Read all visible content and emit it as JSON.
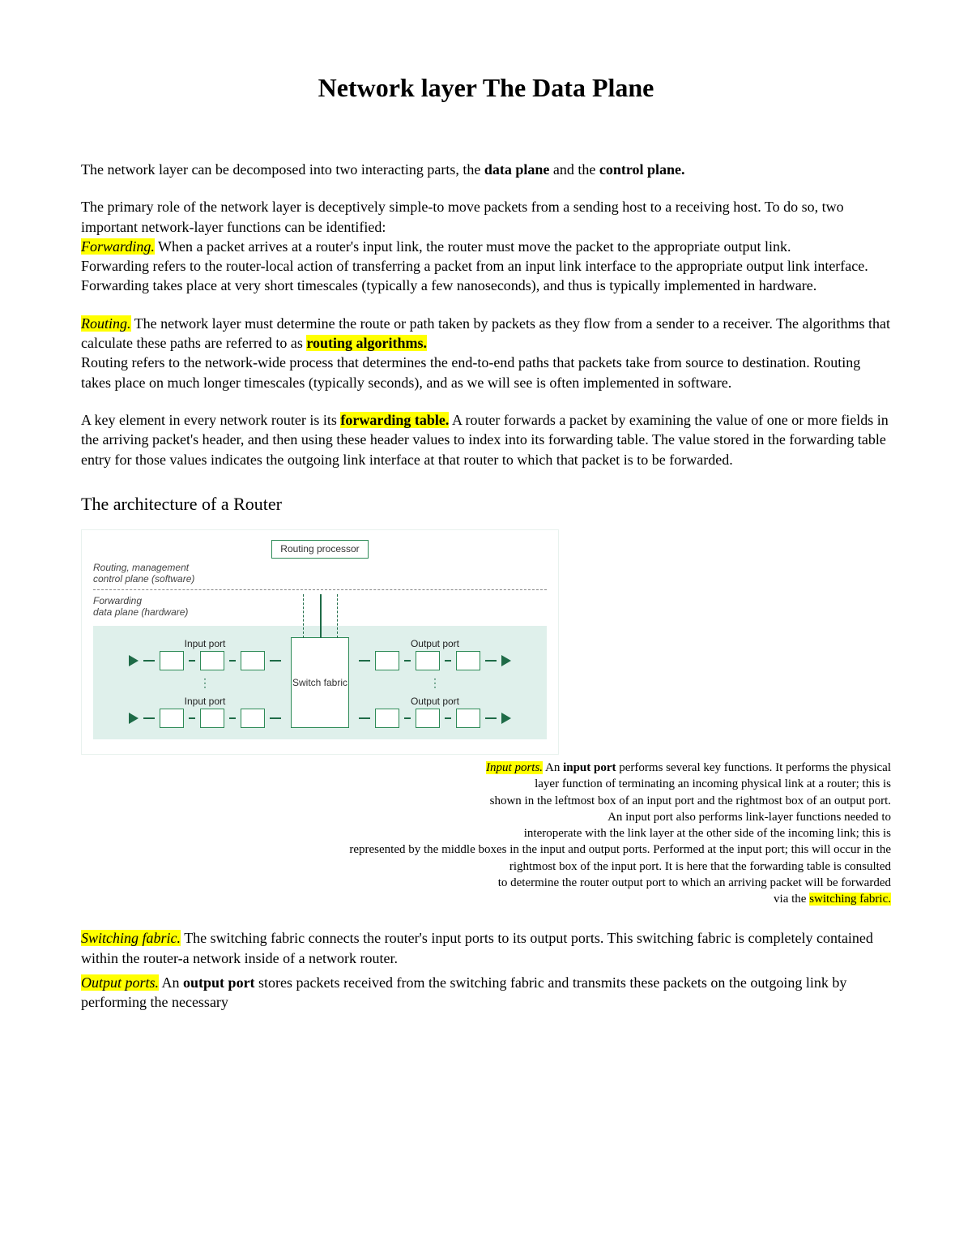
{
  "title": "Network layer The Data Plane",
  "intro": {
    "p1_a": "The network layer can be decomposed into two interacting parts, the ",
    "p1_b": "data plane",
    "p1_c": " and the ",
    "p1_d": "control plane."
  },
  "forwarding": {
    "lead": "The primary role of the network layer is deceptively simple-to move packets from a sending host to a receiving host. To do so, two important network-layer functions can be identified:",
    "label": "Forwarding.",
    "text1": " When a packet arrives at a router's input link, the router must move the packet to the appropriate output link.",
    "text2": "Forwarding refers to the router-local action of transferring a packet from an input link interface to the appropriate output link interface. Forwarding takes place at very short timescales (typically a few nanoseconds), and thus is typically implemented in hardware."
  },
  "routing": {
    "label": "Routing.",
    "text1a": " The network layer must determine the route or path taken by packets as they flow from a sender to a receiver. The algorithms that calculate these paths are referred to as ",
    "hl": "routing algorithms.",
    "text2": "Routing refers to the network-wide process that determines the end-to-end paths that packets take from source to destination. Routing takes place on much longer timescales (typically seconds), and as we will see is often implemented in software."
  },
  "fwdtable": {
    "a": "A key element in every network router is its ",
    "hl": "forwarding table.",
    "b": " A router forwards a packet by examining the value of one or more fields in the arriving packet's header, and then using these header values to index into its forwarding table. The value stored in the forwarding table entry for those values indicates the outgoing link interface at that router to which that packet is to be forwarded."
  },
  "arch_heading": "The architecture of a Router",
  "diagram": {
    "routing_processor": "Routing processor",
    "plane_top_a": "Routing, management",
    "plane_top_b": "control plane (software)",
    "plane_bottom_a": "Forwarding",
    "plane_bottom_b": "data plane (hardware)",
    "input_port": "Input port",
    "output_port": "Output port",
    "switch_fabric": "Switch fabric"
  },
  "input_ports": {
    "label": "Input ports.",
    "a": " An ",
    "b": "input port",
    "c": " performs several key functions. It performs the physical",
    "l2": "layer function of terminating an incoming physical link at a router; this is",
    "l3": "shown in the leftmost box of an input port and the rightmost box of an output port.",
    "l4": "An input port also performs link-layer functions needed to",
    "l5": "interoperate with the link layer at the other side of the incoming link; this is",
    "l6": "represented by the middle boxes in the input and output ports. Performed at the input port; this will occur in the",
    "l7": "rightmost box of the input port. It is here that the forwarding table is consulted",
    "l8a": "to determine the router output port to which an arriving packet will be forwarded",
    "l9a": "via the ",
    "l9hl": "switching fabric."
  },
  "switching_fabric": {
    "label": "Switching fabric.",
    "text": " The switching fabric connects the router's input ports to its output ports. This switching fabric is completely contained within the router-a network inside of a network router."
  },
  "output_ports": {
    "label": "Output ports.",
    "a": " An ",
    "b": "output port",
    "c": " stores packets received from the switching fabric and transmits these packets on the outgoing link by performing the necessary"
  }
}
